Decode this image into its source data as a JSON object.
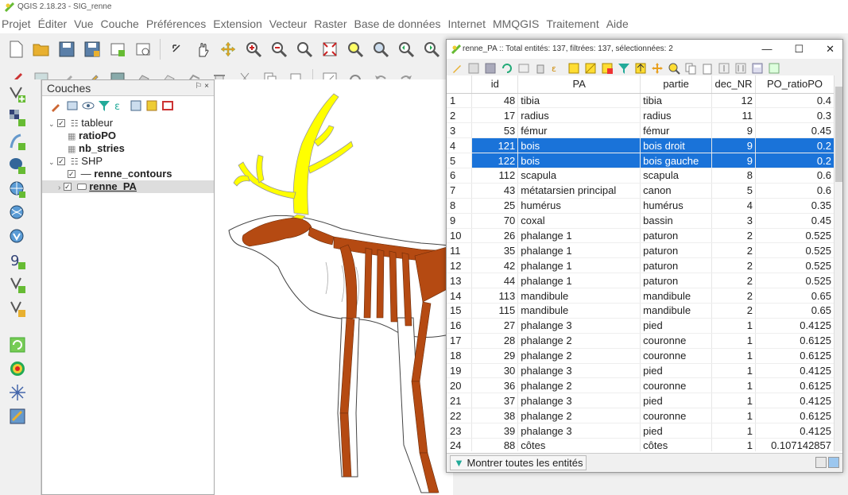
{
  "app_title": "QGIS 2.18.23 - SIG_renne",
  "menu": [
    "Projet",
    "Éditer",
    "Vue",
    "Couche",
    "Préférences",
    "Extension",
    "Vecteur",
    "Raster",
    "Base de données",
    "Internet",
    "MMQGIS",
    "Traitement",
    "Aide"
  ],
  "layers_panel": {
    "title": "Couches",
    "controls": "⚐ ×",
    "tree": [
      {
        "label": "tableur",
        "depth": 0,
        "kind": "group"
      },
      {
        "label": "ratioPO",
        "depth": 1,
        "kind": "table"
      },
      {
        "label": "nb_stries",
        "depth": 1,
        "kind": "table"
      },
      {
        "label": "SHP",
        "depth": 0,
        "kind": "group"
      },
      {
        "label": "renne_contours",
        "depth": 1,
        "kind": "line"
      },
      {
        "label": "renne_PA",
        "depth": 1,
        "kind": "polygon"
      }
    ]
  },
  "attribute_table": {
    "title": "renne_PA :: Total entités: 137, filtrées: 137, sélectionnées: 2",
    "columns": [
      "id",
      "PA",
      "partie",
      "dec_NR",
      "PO_ratioPO"
    ],
    "rows": [
      {
        "n": "1",
        "id": "48",
        "PA": "tibia",
        "partie": "tibia",
        "dec_NR": "12",
        "PO": "0.4",
        "selected": false
      },
      {
        "n": "2",
        "id": "17",
        "PA": "radius",
        "partie": "radius",
        "dec_NR": "11",
        "PO": "0.3",
        "selected": false
      },
      {
        "n": "3",
        "id": "53",
        "PA": "fémur",
        "partie": "fémur",
        "dec_NR": "9",
        "PO": "0.45",
        "selected": false
      },
      {
        "n": "4",
        "id": "121",
        "PA": "bois",
        "partie": "bois droit",
        "dec_NR": "9",
        "PO": "0.2",
        "selected": true
      },
      {
        "n": "5",
        "id": "122",
        "PA": "bois",
        "partie": "bois gauche",
        "dec_NR": "9",
        "PO": "0.2",
        "selected": true
      },
      {
        "n": "6",
        "id": "112",
        "PA": "scapula",
        "partie": "scapula",
        "dec_NR": "8",
        "PO": "0.6",
        "selected": false
      },
      {
        "n": "7",
        "id": "43",
        "PA": "métatarsien principal",
        "partie": "canon",
        "dec_NR": "5",
        "PO": "0.6",
        "selected": false
      },
      {
        "n": "8",
        "id": "25",
        "PA": "humérus",
        "partie": "humérus",
        "dec_NR": "4",
        "PO": "0.35",
        "selected": false
      },
      {
        "n": "9",
        "id": "70",
        "PA": "coxal",
        "partie": "bassin",
        "dec_NR": "3",
        "PO": "0.45",
        "selected": false
      },
      {
        "n": "10",
        "id": "26",
        "PA": "phalange 1",
        "partie": "paturon",
        "dec_NR": "2",
        "PO": "0.525",
        "selected": false
      },
      {
        "n": "11",
        "id": "35",
        "PA": "phalange 1",
        "partie": "paturon",
        "dec_NR": "2",
        "PO": "0.525",
        "selected": false
      },
      {
        "n": "12",
        "id": "42",
        "PA": "phalange 1",
        "partie": "paturon",
        "dec_NR": "2",
        "PO": "0.525",
        "selected": false
      },
      {
        "n": "13",
        "id": "44",
        "PA": "phalange 1",
        "partie": "paturon",
        "dec_NR": "2",
        "PO": "0.525",
        "selected": false
      },
      {
        "n": "14",
        "id": "113",
        "PA": "mandibule",
        "partie": "mandibule",
        "dec_NR": "2",
        "PO": "0.65",
        "selected": false
      },
      {
        "n": "15",
        "id": "115",
        "PA": "mandibule",
        "partie": "mandibule",
        "dec_NR": "2",
        "PO": "0.65",
        "selected": false
      },
      {
        "n": "16",
        "id": "27",
        "PA": "phalange 3",
        "partie": "pied",
        "dec_NR": "1",
        "PO": "0.4125",
        "selected": false
      },
      {
        "n": "17",
        "id": "28",
        "PA": "phalange 2",
        "partie": "couronne",
        "dec_NR": "1",
        "PO": "0.6125",
        "selected": false
      },
      {
        "n": "18",
        "id": "29",
        "PA": "phalange 2",
        "partie": "couronne",
        "dec_NR": "1",
        "PO": "0.6125",
        "selected": false
      },
      {
        "n": "19",
        "id": "30",
        "PA": "phalange 3",
        "partie": "pied",
        "dec_NR": "1",
        "PO": "0.4125",
        "selected": false
      },
      {
        "n": "20",
        "id": "36",
        "PA": "phalange 2",
        "partie": "couronne",
        "dec_NR": "1",
        "PO": "0.6125",
        "selected": false
      },
      {
        "n": "21",
        "id": "37",
        "PA": "phalange 3",
        "partie": "pied",
        "dec_NR": "1",
        "PO": "0.4125",
        "selected": false
      },
      {
        "n": "22",
        "id": "38",
        "PA": "phalange 2",
        "partie": "couronne",
        "dec_NR": "1",
        "PO": "0.6125",
        "selected": false
      },
      {
        "n": "23",
        "id": "39",
        "PA": "phalange 3",
        "partie": "pied",
        "dec_NR": "1",
        "PO": "0.4125",
        "selected": false
      },
      {
        "n": "24",
        "id": "88",
        "PA": "côtes",
        "partie": "côtes",
        "dec_NR": "1",
        "PO": "0.107142857",
        "selected": false
      }
    ],
    "filter_button": "Montrer toutes les entités",
    "window_buttons": {
      "minimize": "—",
      "maximize": "☐",
      "close": "✕"
    }
  },
  "colors": {
    "selection": "#1a73d9",
    "antler": "#ffff00",
    "bone": "#b54a12"
  }
}
